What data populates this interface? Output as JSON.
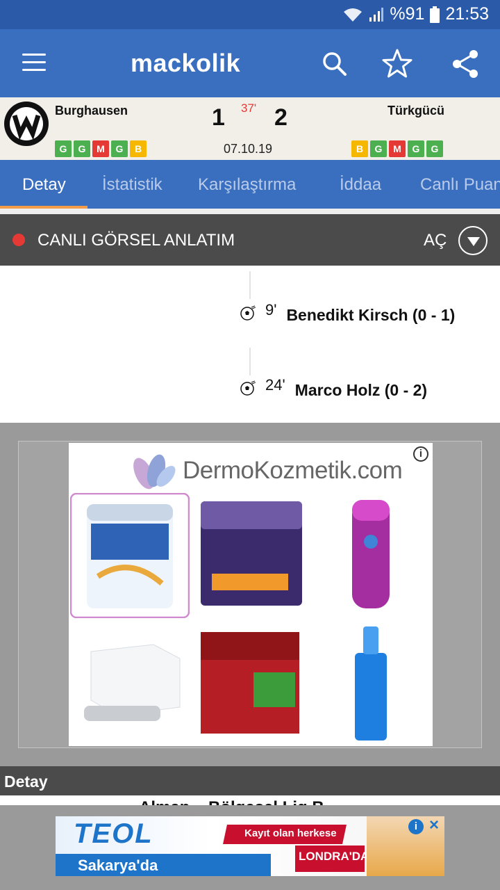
{
  "status_bar": {
    "battery_text": "%91",
    "time": "21:53"
  },
  "app_bar": {
    "logo_text": "mackolik",
    "icons": [
      "menu-icon",
      "search-icon",
      "star-icon",
      "share-icon"
    ]
  },
  "match": {
    "home_team": "Burghausen",
    "away_team": "Türkgücü",
    "home_score": "1",
    "away_score": "2",
    "minute": "37'",
    "date": "07.10.19",
    "home_form": [
      "G",
      "G",
      "M",
      "G",
      "B"
    ],
    "away_form": [
      "B",
      "G",
      "M",
      "G",
      "G"
    ]
  },
  "tabs": [
    {
      "label": "Detay",
      "active": true
    },
    {
      "label": "İstatistik",
      "active": false
    },
    {
      "label": "Karşılaştırma",
      "active": false
    },
    {
      "label": "İddaa",
      "active": false
    },
    {
      "label": "Canlı Puan",
      "active": false
    }
  ],
  "live_narration": {
    "title": "CANLI GÖRSEL ANLATIM",
    "toggle_label": "AÇ"
  },
  "events": [
    {
      "minute": "9'",
      "text": "Benedikt Kirsch (0 - 1)"
    },
    {
      "minute": "24'",
      "text": "Marco Holz (0 - 2)"
    }
  ],
  "ad": {
    "brand": "DermoKozmetik.com",
    "info_icon": "i"
  },
  "detay": {
    "label": "Detay",
    "cut_text": "Alman... Bölgesel Lig B..."
  },
  "banner": {
    "logo": "TEOL",
    "city": "Sakarya'da",
    "promo": "Kayıt olan herkese",
    "promo2": "LONDRA'DA",
    "info_icon": "i",
    "close_icon": "×"
  },
  "colors": {
    "primary": "#3a6fc0",
    "accent": "#f39c4a",
    "live_dot": "#e53935",
    "form_win": "#4caf50",
    "form_loss": "#e53935",
    "form_draw": "#f5b700"
  }
}
